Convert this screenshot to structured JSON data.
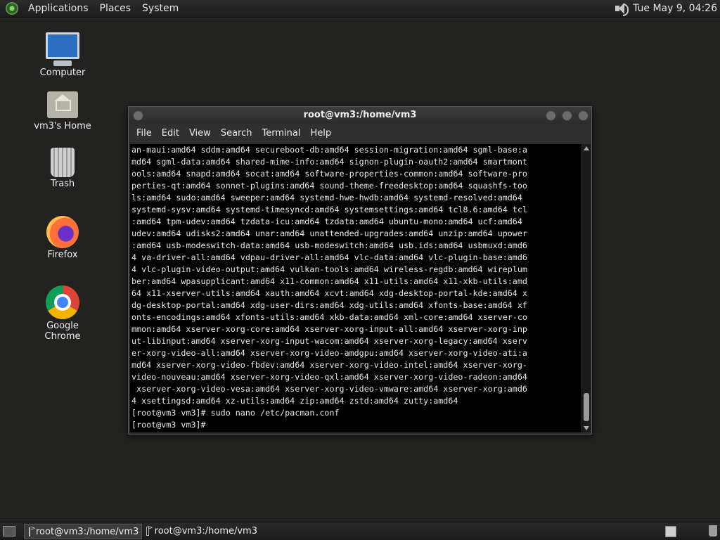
{
  "top_panel": {
    "menus": [
      "Applications",
      "Places",
      "System"
    ],
    "clock": "Tue May  9, 04:26"
  },
  "desktop_icons": [
    {
      "label": "Computer",
      "icon": "computer-icon"
    },
    {
      "label": "vm3's Home",
      "icon": "home-folder-icon"
    },
    {
      "label": "Trash",
      "icon": "trash-icon"
    },
    {
      "label": "Firefox",
      "icon": "firefox-icon"
    },
    {
      "label": "Google Chrome",
      "icon": "chrome-icon"
    }
  ],
  "terminal": {
    "title": "root@vm3:/home/vm3",
    "menu": [
      "File",
      "Edit",
      "View",
      "Search",
      "Terminal",
      "Help"
    ],
    "lines": [
      "an-maui:amd64 sddm:amd64 secureboot-db:amd64 session-migration:amd64 sgml-base:a",
      "md64 sgml-data:amd64 shared-mime-info:amd64 signon-plugin-oauth2:amd64 smartmont",
      "ools:amd64 snapd:amd64 socat:amd64 software-properties-common:amd64 software-pro",
      "perties-qt:amd64 sonnet-plugins:amd64 sound-theme-freedesktop:amd64 squashfs-too",
      "ls:amd64 sudo:amd64 sweeper:amd64 systemd-hwe-hwdb:amd64 systemd-resolved:amd64 ",
      "systemd-sysv:amd64 systemd-timesyncd:amd64 systemsettings:amd64 tcl8.6:amd64 tcl",
      ":amd64 tpm-udev:amd64 tzdata-icu:amd64 tzdata:amd64 ubuntu-mono:amd64 ucf:amd64 ",
      "udev:amd64 udisks2:amd64 unar:amd64 unattended-upgrades:amd64 unzip:amd64 upower",
      ":amd64 usb-modeswitch-data:amd64 usb-modeswitch:amd64 usb.ids:amd64 usbmuxd:amd6",
      "4 va-driver-all:amd64 vdpau-driver-all:amd64 vlc-data:amd64 vlc-plugin-base:amd6",
      "4 vlc-plugin-video-output:amd64 vulkan-tools:amd64 wireless-regdb:amd64 wireplum",
      "ber:amd64 wpasupplicant:amd64 x11-common:amd64 x11-utils:amd64 x11-xkb-utils:amd",
      "64 x11-xserver-utils:amd64 xauth:amd64 xcvt:amd64 xdg-desktop-portal-kde:amd64 x",
      "dg-desktop-portal:amd64 xdg-user-dirs:amd64 xdg-utils:amd64 xfonts-base:amd64 xf",
      "onts-encodings:amd64 xfonts-utils:amd64 xkb-data:amd64 xml-core:amd64 xserver-co",
      "mmon:amd64 xserver-xorg-core:amd64 xserver-xorg-input-all:amd64 xserver-xorg-inp",
      "ut-libinput:amd64 xserver-xorg-input-wacom:amd64 xserver-xorg-legacy:amd64 xserv",
      "er-xorg-video-all:amd64 xserver-xorg-video-amdgpu:amd64 xserver-xorg-video-ati:a",
      "md64 xserver-xorg-video-fbdev:amd64 xserver-xorg-video-intel:amd64 xserver-xorg-",
      "video-nouveau:amd64 xserver-xorg-video-qxl:amd64 xserver-xorg-video-radeon:amd64",
      " xserver-xorg-video-vesa:amd64 xserver-xorg-video-vmware:amd64 xserver-xorg:amd6",
      "4 xsettingsd:amd64 xz-utils:amd64 zip:amd64 zstd:amd64 zutty:amd64",
      "[root@vm3 vm3]# sudo nano /etc/pacman.conf",
      "[root@vm3 vm3]# "
    ]
  },
  "taskbar": {
    "tasks": [
      {
        "label": "root@vm3:/home/vm3",
        "active": true
      },
      {
        "label": "root@vm3:/home/vm3",
        "active": false
      }
    ]
  }
}
